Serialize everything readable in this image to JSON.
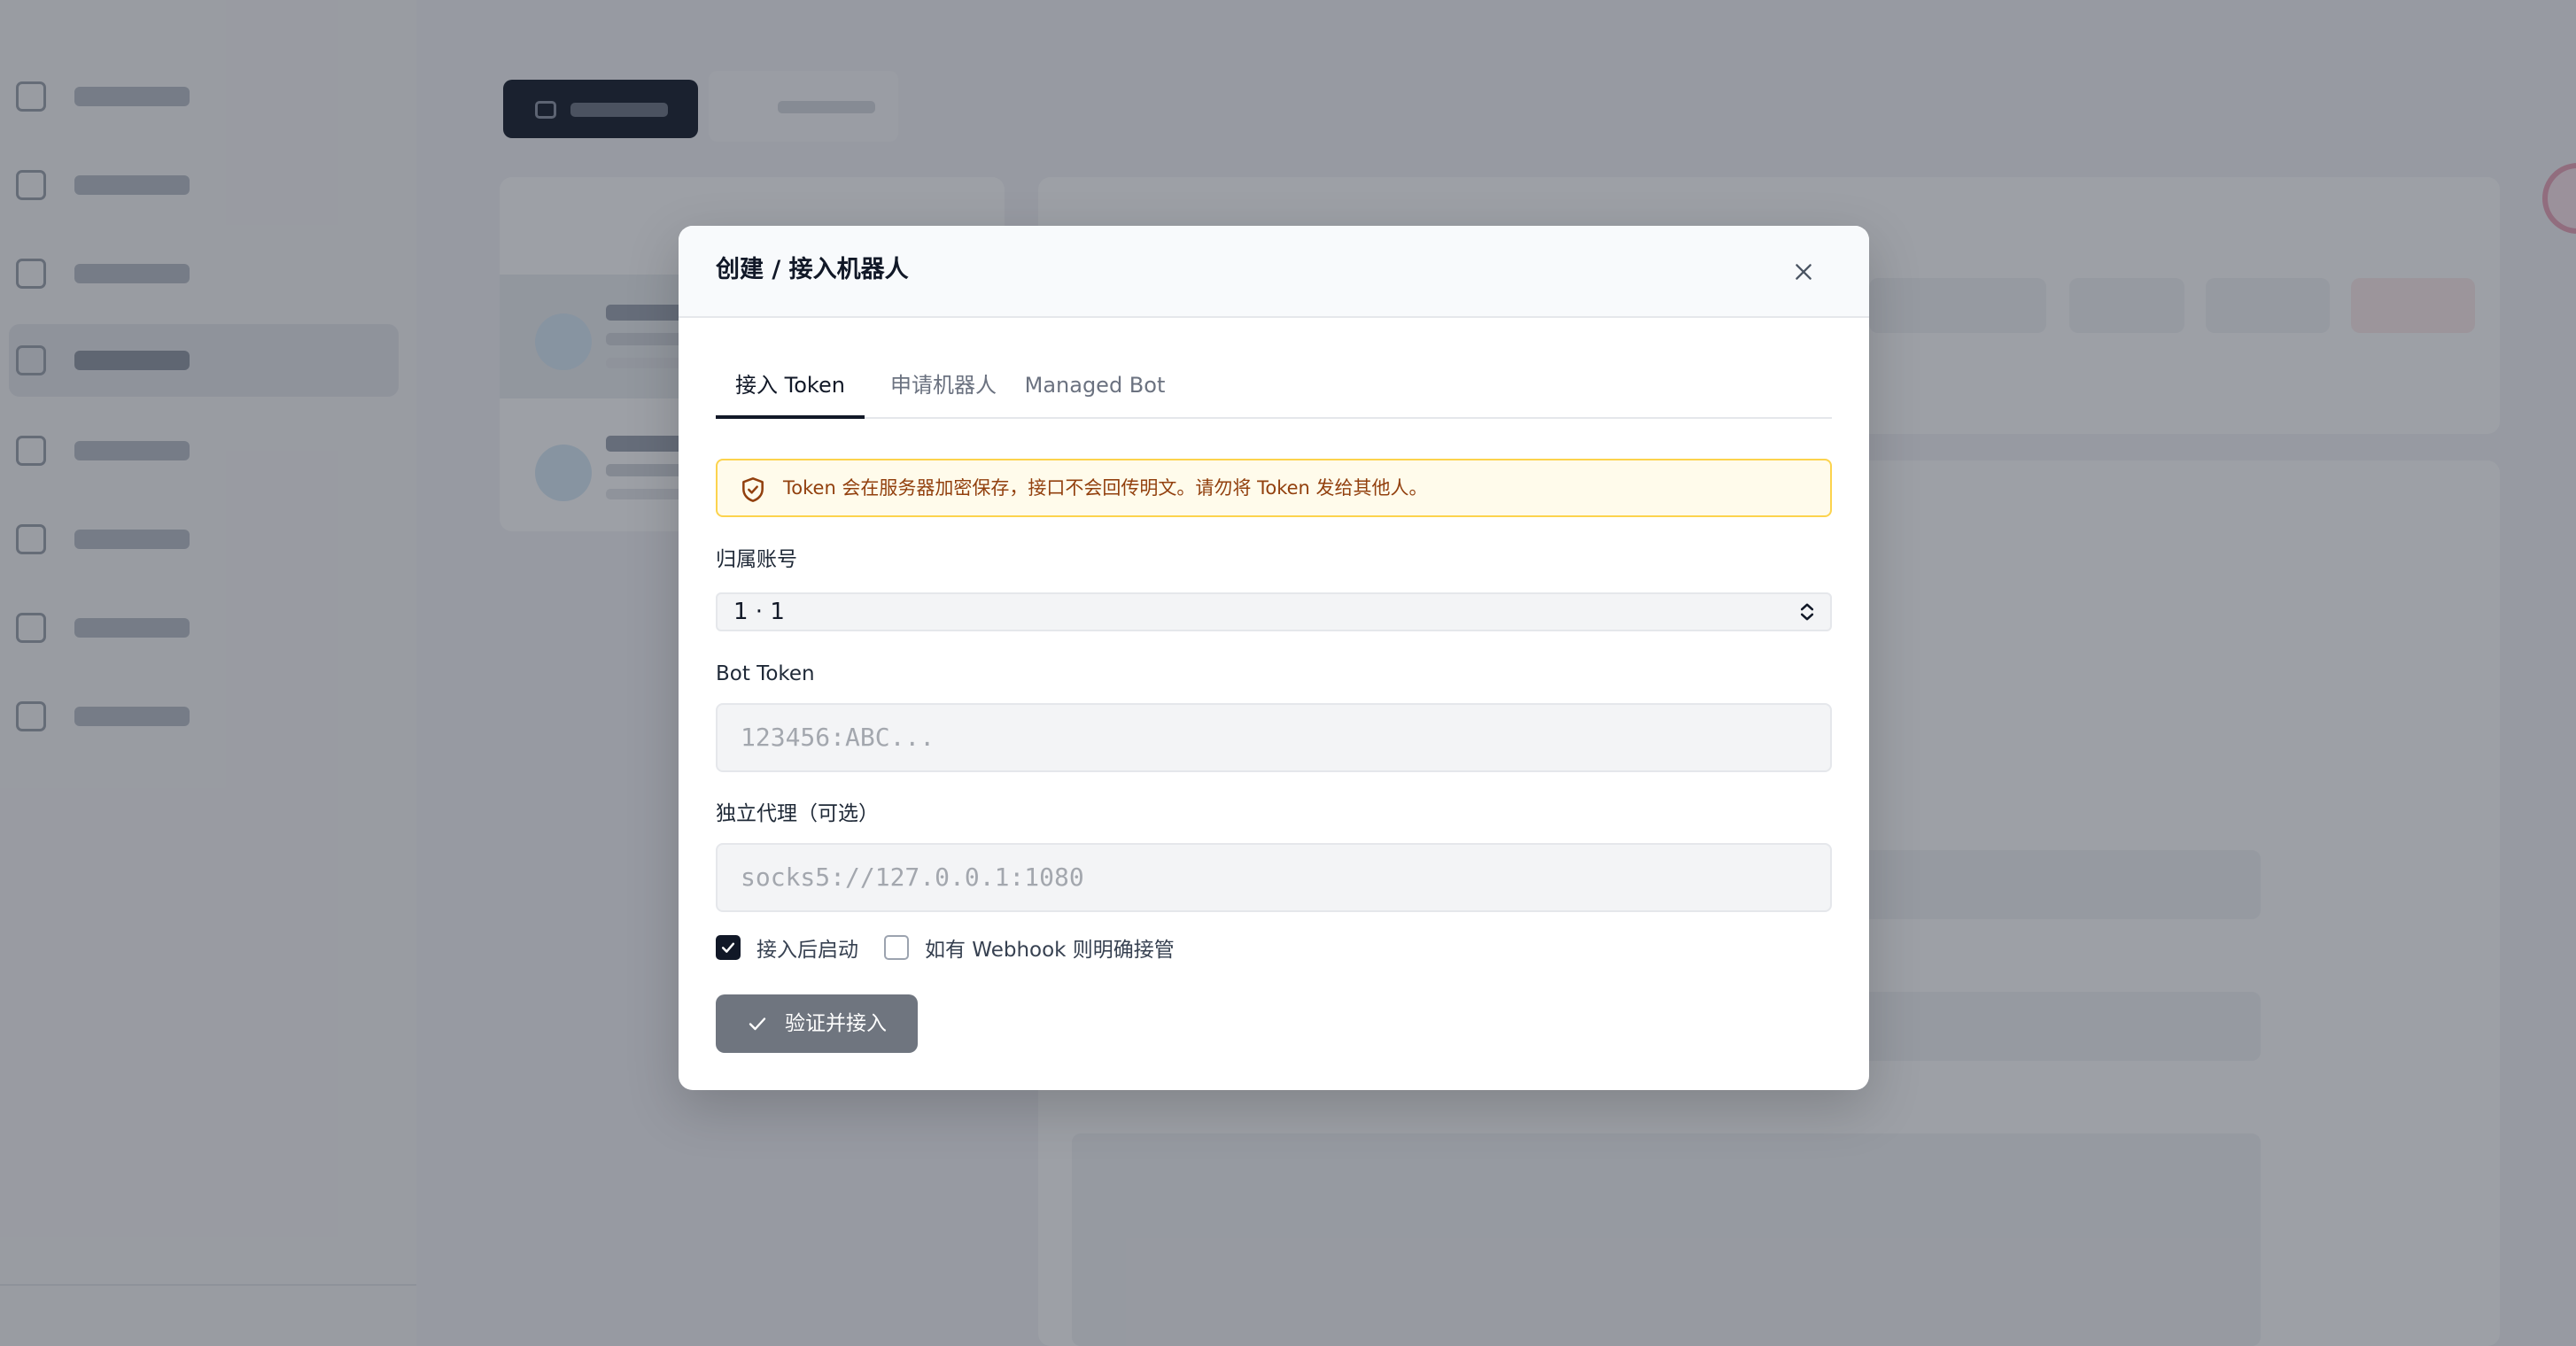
{
  "modal": {
    "title": "创建 / 接入机器人",
    "tabs": [
      {
        "label": "接入 Token",
        "active": true
      },
      {
        "label": "申请机器人",
        "active": false
      },
      {
        "label": "Managed Bot",
        "active": false
      }
    ],
    "alert": {
      "icon": "shield-check-icon",
      "text": "Token 会在服务器加密保存，接口不会回传明文。请勿将 Token 发给其他人。"
    },
    "account": {
      "label": "归属账号",
      "selected": "1 · 1"
    },
    "bot_token": {
      "label": "Bot Token",
      "placeholder": "123456:ABC..."
    },
    "proxy": {
      "label": "独立代理（可选）",
      "placeholder": "socks5://127.0.0.1:1080"
    },
    "options": [
      {
        "label": "接入后启动",
        "checked": true
      },
      {
        "label": "如有 Webhook 则明确接管",
        "checked": false
      }
    ],
    "submit": {
      "label": "验证并接入",
      "icon": "check-icon"
    }
  },
  "colors": {
    "primary": "#111827",
    "alert_bg": "#fffbeb",
    "alert_border": "#fcd34d",
    "alert_text": "#92400e",
    "submit_bg": "#6f757f"
  }
}
